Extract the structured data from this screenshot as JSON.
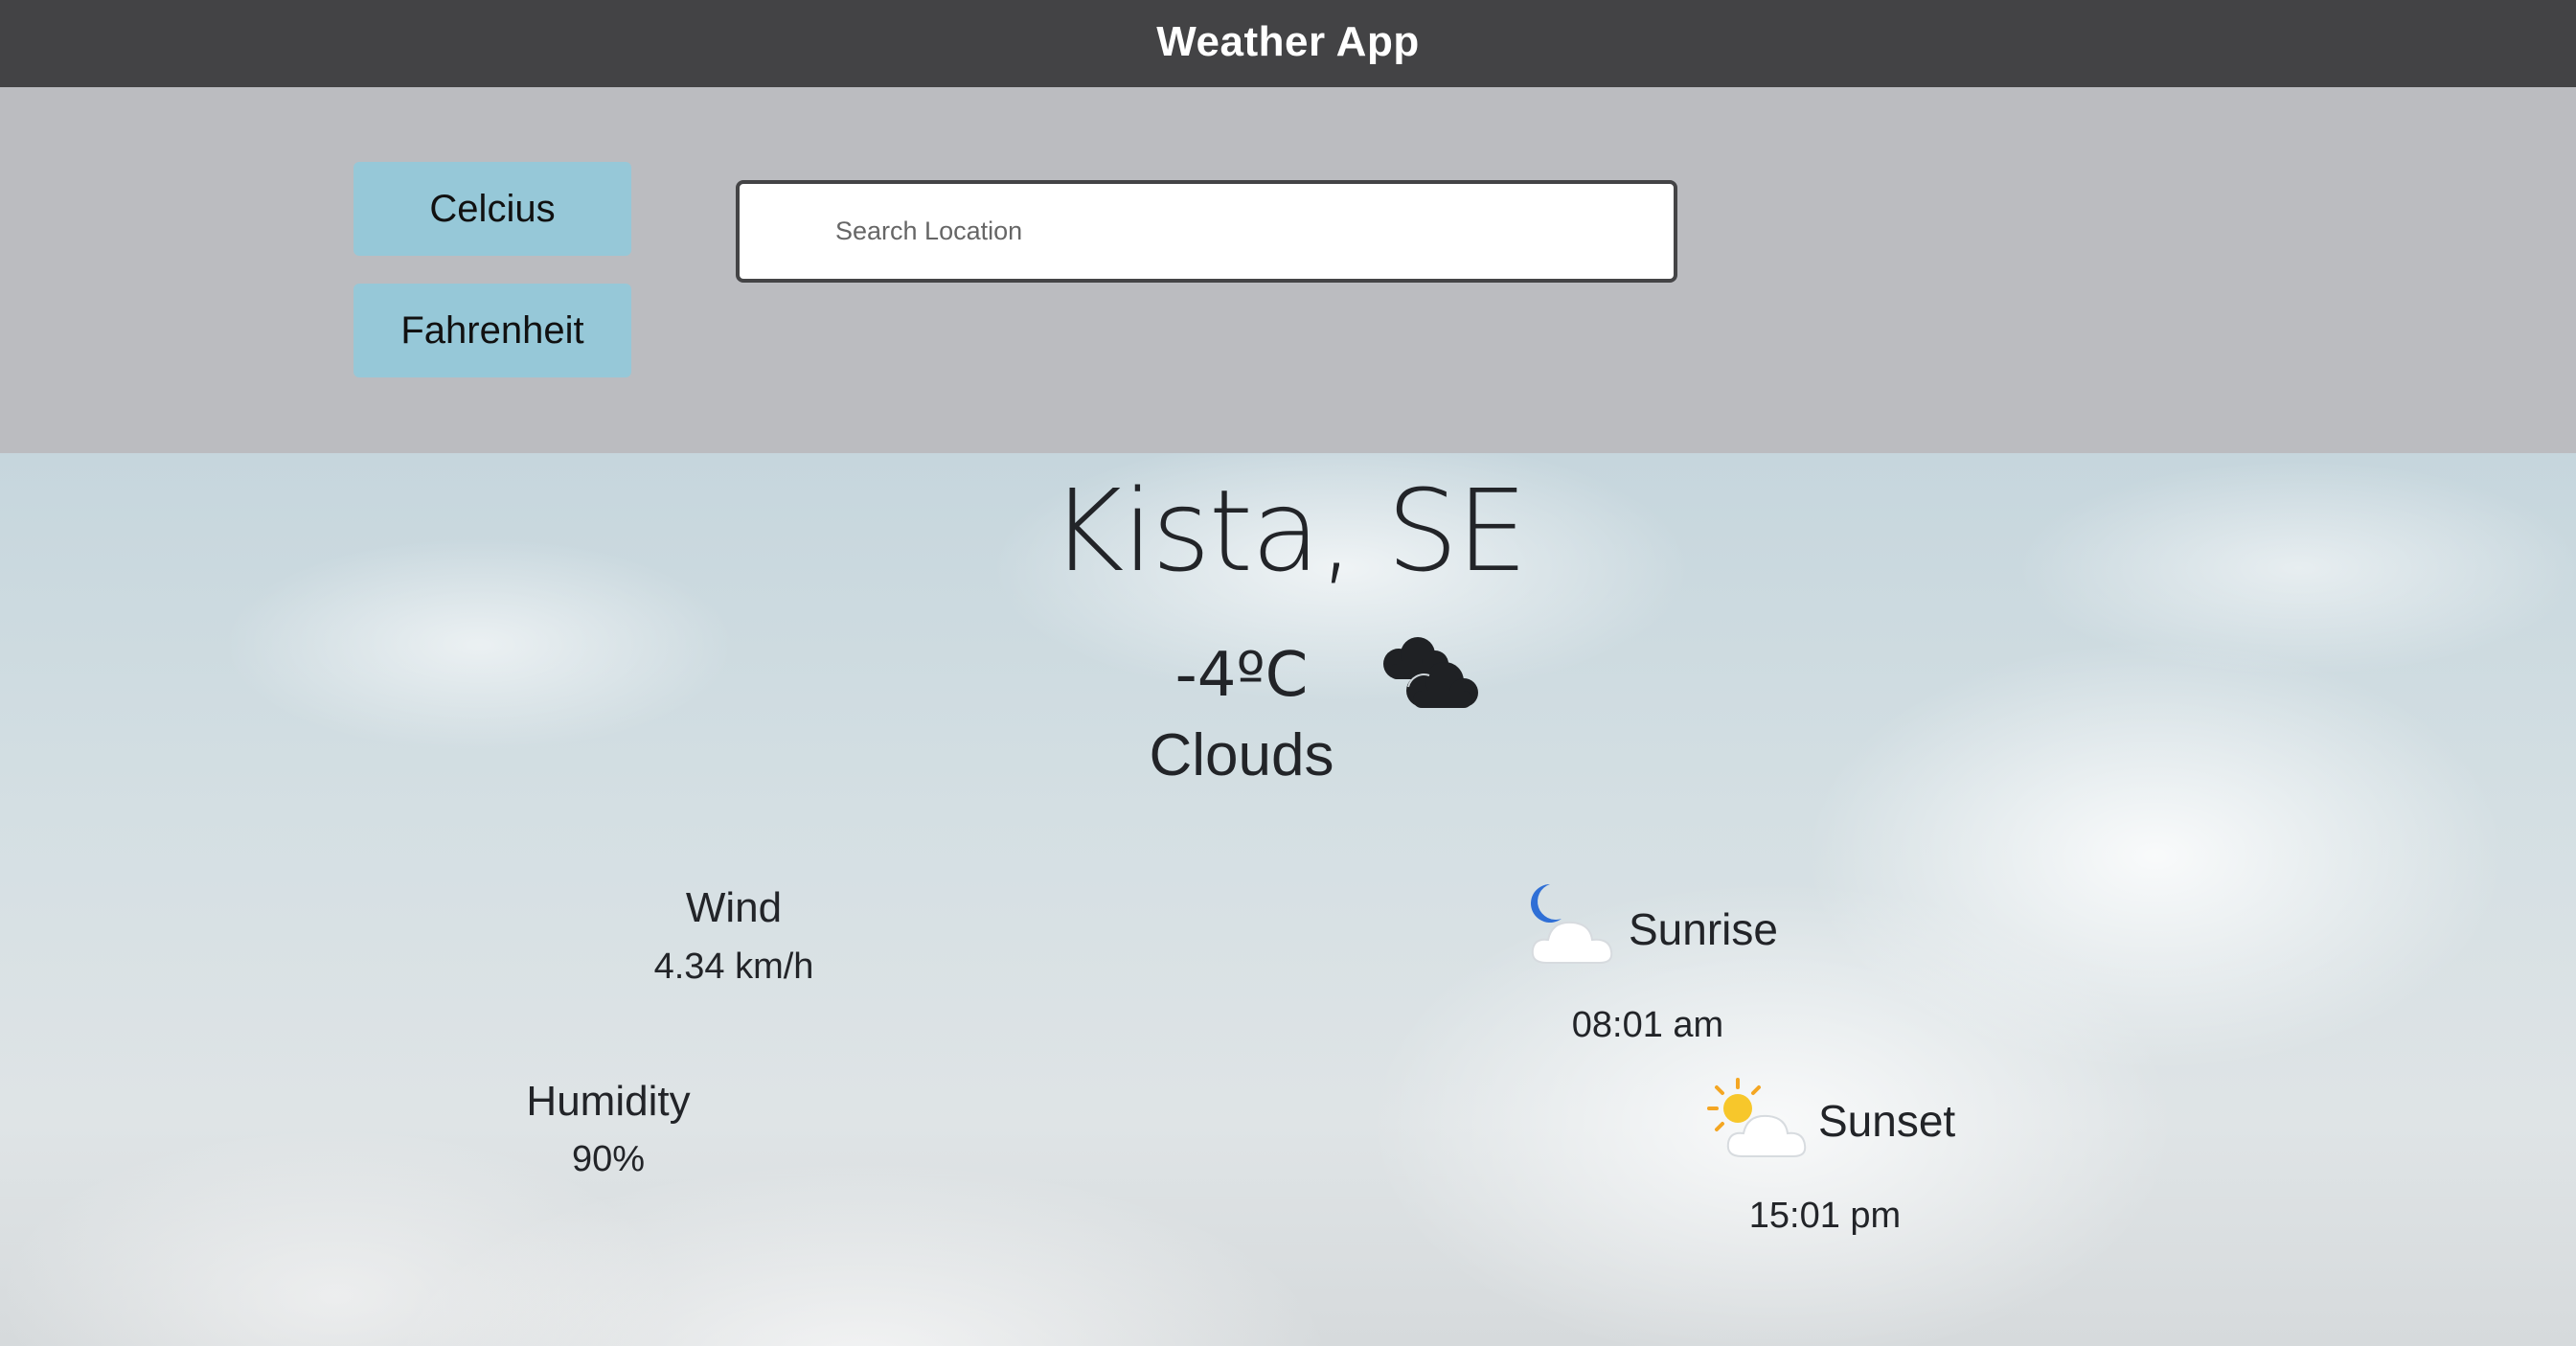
{
  "header": {
    "title": "Weather App"
  },
  "controls": {
    "celsius_label": "Celcius",
    "fahrenheit_label": "Fahrenheit",
    "search": {
      "placeholder": "Search Location",
      "value": ""
    }
  },
  "weather": {
    "city": "Kista, SE",
    "temperature": "-4ºC",
    "condition": "Clouds",
    "condition_icon": "clouds-icon",
    "wind": {
      "label": "Wind",
      "value": "4.34 km/h"
    },
    "humidity": {
      "label": "Humidity",
      "value": "90%"
    },
    "sunrise": {
      "label": "Sunrise",
      "time": "08:01 am",
      "icon": "moon-cloud-icon"
    },
    "sunset": {
      "label": "Sunset",
      "time": "15:01 pm",
      "icon": "sun-cloud-icon"
    }
  },
  "colors": {
    "header_bg": "#434345",
    "controls_bg": "#bbbcc0",
    "button_bg": "#96c8d8",
    "text_dark": "#222428"
  }
}
